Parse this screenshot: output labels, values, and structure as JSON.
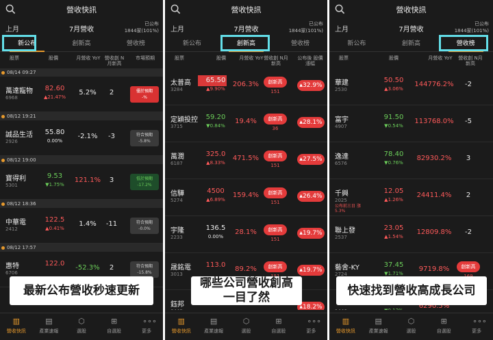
{
  "app": {
    "title": "營收快訊",
    "prev_month": "上月",
    "month": "7月營收",
    "published_label": "已公布",
    "published_count": "1844家(101%)"
  },
  "tabs": [
    "新公布",
    "創新高",
    "營收榜"
  ],
  "nav": [
    "營收快訊",
    "產業速報",
    "選股",
    "自選股",
    "更多"
  ],
  "colors": {
    "accent": "#e89a2c",
    "up": "#ff5a5a",
    "down": "#6ccf5a",
    "highlight": "#64e0ea"
  },
  "panel1": {
    "columns": {
      "stock": "股票",
      "price": "股價",
      "yoy": "月營收 YoY",
      "high": "營收創 N月新高",
      "expect": "市場預期"
    },
    "sections": [
      {
        "time": "08/14 09:27",
        "rows": [
          {
            "name": "萬達寵物",
            "code": "6968",
            "price": "82.60",
            "change": "21.47%",
            "dir": "up",
            "yoy": "5.2%",
            "yoy_dir": "fl",
            "n": "2",
            "expect": [
              "優於預期",
              "-%"
            ],
            "expect_style": "r"
          }
        ]
      },
      {
        "time": "08/12 19:21",
        "rows": [
          {
            "name": "誠品生活",
            "code": "2926",
            "price": "55.80",
            "change": "0.00%",
            "dir": "fl",
            "yoy": "-2.1%",
            "yoy_dir": "fl",
            "n": "-3",
            "expect": [
              "符合預期",
              "-5.8%"
            ],
            "expect_style": "n"
          }
        ]
      },
      {
        "time": "08/12 19:00",
        "rows": [
          {
            "name": "寶得利",
            "code": "5301",
            "price": "9.53",
            "change": "1.75%",
            "dir": "dn",
            "yoy": "121.1%",
            "yoy_dir": "up",
            "n": "3",
            "expect": [
              "低於預期",
              "-17.2%"
            ],
            "expect_style": "g"
          }
        ]
      },
      {
        "time": "08/12 18:36",
        "rows": [
          {
            "name": "中華電",
            "code": "2412",
            "price": "122.5",
            "change": "0.41%",
            "dir": "up",
            "yoy": "1.4%",
            "yoy_dir": "fl",
            "n": "-11",
            "expect": [
              "符合預期",
              "-0.0%"
            ],
            "expect_style": "n"
          }
        ]
      },
      {
        "time": "08/12 17:57",
        "rows": [
          {
            "name": "惠特",
            "code": "6706",
            "price": "122.0",
            "change": "",
            "dir": "up",
            "yoy": "-52.3%",
            "yoy_dir": "dn",
            "n": "2",
            "expect": [
              "符合預期",
              "-15.8%"
            ],
            "expect_style": "n"
          }
        ]
      }
    ],
    "caption": "最新公布營收秒速更新"
  },
  "panel2": {
    "columns": {
      "stock": "股票",
      "price": "股價",
      "yoy": "月營收 YoY",
      "high": "營收創 N月新高",
      "gain": "公布後 股價漲幅"
    },
    "rows": [
      {
        "name": "太普高",
        "code": "3284",
        "price": "65.50",
        "change": "9.90%",
        "dir": "up",
        "yoy": "206.3%",
        "badge": "創新高",
        "n": "151",
        "gain": "32.9%",
        "hl": true
      },
      {
        "name": "定穎投控",
        "code": "3715",
        "price": "59.20",
        "change": "0.84%",
        "dir": "dn",
        "yoy": "19.4%",
        "badge": "創新高",
        "n": "36",
        "gain": "28.1%",
        "hl": false
      },
      {
        "name": "萬潤",
        "code": "6187",
        "price": "325.0",
        "change": "8.33%",
        "dir": "up",
        "yoy": "471.5%",
        "badge": "創新高",
        "n": "151",
        "gain": "27.5%",
        "hl": false
      },
      {
        "name": "信驊",
        "code": "5274",
        "price": "4500",
        "change": "6.89%",
        "dir": "up",
        "yoy": "159.4%",
        "badge": "創新高",
        "n": "151",
        "gain": "26.4%",
        "hl": false
      },
      {
        "name": "宇隆",
        "code": "2233",
        "price": "136.5",
        "change": "0.00%",
        "dir": "fl",
        "yoy": "28.1%",
        "badge": "創新高",
        "n": "151",
        "gain": "19.7%",
        "hl": false
      },
      {
        "name": "晟銘電",
        "code": "3013",
        "price": "113.0",
        "change": "",
        "dir": "up",
        "yoy": "89.2%",
        "badge": "創新高",
        "n": "151",
        "gain": "19.7%",
        "hl": false
      },
      {
        "name": "鈺邦",
        "code": "6449",
        "price": "",
        "change": "",
        "dir": "dn",
        "yoy": "",
        "badge": "",
        "n": "",
        "gain": "18.2%",
        "hl": false
      }
    ],
    "caption": [
      "哪些公司營收創高",
      "一目了然"
    ]
  },
  "panel3": {
    "columns": {
      "stock": "股票",
      "price": "股價",
      "yoy": "月營收 YoY",
      "high": "營收創 N月新高"
    },
    "rows": [
      {
        "name": "華建",
        "code": "2530",
        "price": "50.50",
        "change": "3.06%",
        "dir": "up",
        "yoy": "144776.2%",
        "n": "-2",
        "badge": "",
        "note": ""
      },
      {
        "name": "富宇",
        "code": "4907",
        "price": "91.50",
        "change": "0.54%",
        "dir": "dn",
        "yoy": "113768.0%",
        "n": "-5",
        "badge": "",
        "note": ""
      },
      {
        "name": "逸達",
        "code": "6576",
        "price": "78.40",
        "change": "0.76%",
        "dir": "dn",
        "yoy": "82930.2%",
        "n": "3",
        "badge": "",
        "note": ""
      },
      {
        "name": "千興",
        "code": "2025",
        "price": "12.05",
        "change": "1.26%",
        "dir": "up",
        "yoy": "24411.4%",
        "n": "2",
        "badge": "",
        "note": "公布前三日 漲5.3%"
      },
      {
        "name": "聯上發",
        "code": "2537",
        "price": "23.05",
        "change": "1.54%",
        "dir": "up",
        "yoy": "12809.8%",
        "n": "-2",
        "badge": "",
        "note": ""
      },
      {
        "name": "藝舍-KY",
        "code": "2724",
        "price": "37.45",
        "change": "1.71%",
        "dir": "dn",
        "yoy": "9719.8%",
        "n": "169",
        "badge": "創新高",
        "note": ""
      },
      {
        "name": "",
        "code": "1446",
        "price": "51.40",
        "change": "0.12%",
        "dir": "dn",
        "yoy": "6290.5%",
        "n": "",
        "badge": "",
        "note": ""
      }
    ],
    "caption": "快速找到營收高成長公司"
  }
}
